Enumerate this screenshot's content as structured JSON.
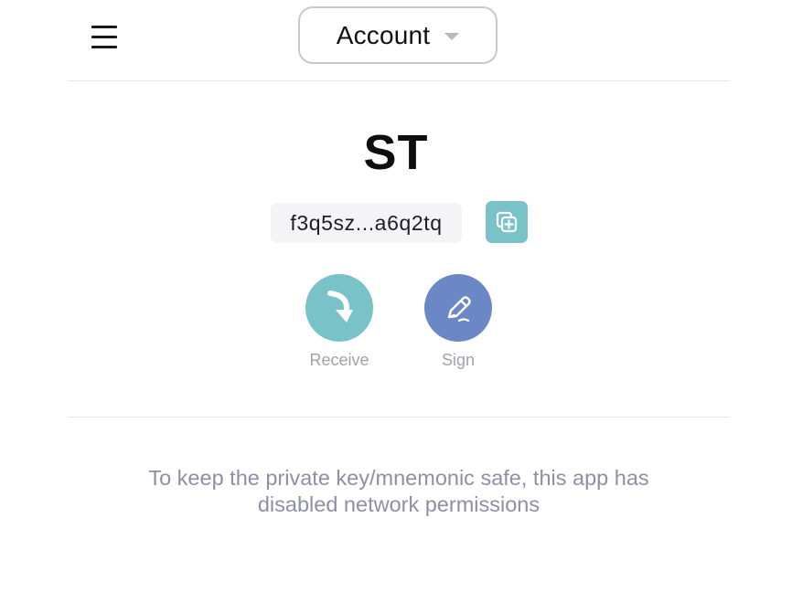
{
  "header": {
    "menu_icon": "hamburger-menu-icon",
    "account_selector": {
      "label": "Account",
      "icon": "caret-down-icon",
      "caret_color": "#b9b9b9"
    }
  },
  "account": {
    "name": "ST",
    "address_short": "f3q5sz...a6q2tq",
    "copy_icon": "copy-icon",
    "copy_color": "#79c3c8"
  },
  "actions": [
    {
      "label": "Receive",
      "icon": "receive-arrow-icon",
      "color": "#79c3c8"
    },
    {
      "label": "Sign",
      "icon": "pen-icon",
      "color": "#6b87c5"
    }
  ],
  "notice": {
    "text": "To keep the private key/mnemonic safe, this app has disabled network permissions"
  }
}
